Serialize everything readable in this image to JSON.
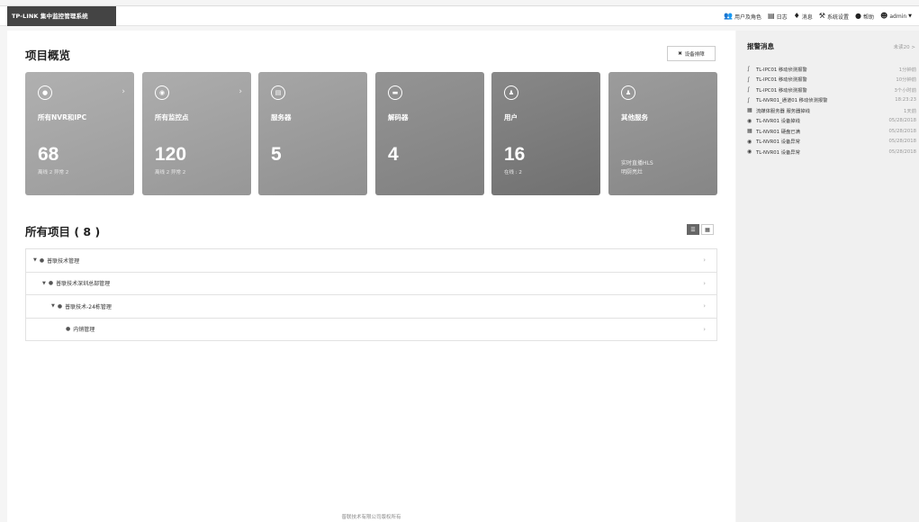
{
  "header": {
    "brand": "TP-LINK 集中监控管理系统",
    "nav": [
      {
        "icon": "users-icon",
        "label": "用户及角色"
      },
      {
        "icon": "log-icon",
        "label": "日志"
      },
      {
        "icon": "bell-icon",
        "label": "消息"
      },
      {
        "icon": "wrench-icon",
        "label": "系统设置"
      },
      {
        "icon": "info-icon",
        "label": "帮助"
      },
      {
        "icon": "user-icon",
        "label": "admin"
      }
    ]
  },
  "overview": {
    "title": "项目概览",
    "fault_button": "设备排障",
    "cards": [
      {
        "name": "所有NVR和IPC",
        "value": "68",
        "sub": "离线 2    异常 2",
        "icon": "camera-icon",
        "color": "#a6a6a6"
      },
      {
        "name": "所有监控点",
        "value": "120",
        "sub": "离线 2    异常 2",
        "icon": "location-icon",
        "color": "#a2a2a2"
      },
      {
        "name": "服务器",
        "value": "5",
        "sub": "",
        "icon": "server-icon",
        "color": "#9a9a9a"
      },
      {
        "name": "解码器",
        "value": "4",
        "sub": "",
        "icon": "decoder-icon",
        "color": "#8a8a8a"
      },
      {
        "name": "用户",
        "value": "16",
        "sub": "在线 : 2",
        "icon": "users-icon",
        "color": "#7c7c7c"
      },
      {
        "name": "其他服务",
        "value": "",
        "sub": "",
        "line1": "实时直播HLS",
        "line2": "明厨亮灶",
        "icon": "group-icon",
        "color": "#909090"
      }
    ]
  },
  "projects": {
    "title": "所有项目 ( 8 )",
    "rows": [
      {
        "label": "普联技术管理",
        "indent": 0,
        "expanded": true
      },
      {
        "label": "普联技术深圳总部管理",
        "indent": 1,
        "expanded": true
      },
      {
        "label": "普联技术-24栋管理",
        "indent": 2,
        "expanded": true
      },
      {
        "label": "内销管理",
        "indent": 3,
        "expanded": false
      }
    ]
  },
  "footer": "普联技术有限公司版权所有",
  "alerts": {
    "title": "报警消息",
    "unread": "未读20 >",
    "items": [
      {
        "icon": "motion-icon",
        "text": "TL-IPC01 移动侦测报警",
        "time": "1分钟前"
      },
      {
        "icon": "motion-icon",
        "text": "TL-IPC01 移动侦测报警",
        "time": "10分钟前"
      },
      {
        "icon": "motion-icon",
        "text": "TL-IPC01 移动侦测报警",
        "time": "3个小时前"
      },
      {
        "icon": "motion-icon",
        "text": "TL-NVR01_通道01 移动侦测报警",
        "time": "18:23:23"
      },
      {
        "icon": "server-alert-icon",
        "text": "流媒体服务器 服务器掉线",
        "time": "1天前"
      },
      {
        "icon": "nvr-icon",
        "text": "TL-NVR01 设备掉线",
        "time": "05/28/2018"
      },
      {
        "icon": "disk-icon",
        "text": "TL-NVR01 硬盘已满",
        "time": "05/28/2018"
      },
      {
        "icon": "nvr-icon",
        "text": "TL-NVR01 设备异常",
        "time": "05/28/2018"
      },
      {
        "icon": "nvr-icon",
        "text": "TL-NVR01 设备异常",
        "time": "05/28/2018"
      }
    ]
  }
}
